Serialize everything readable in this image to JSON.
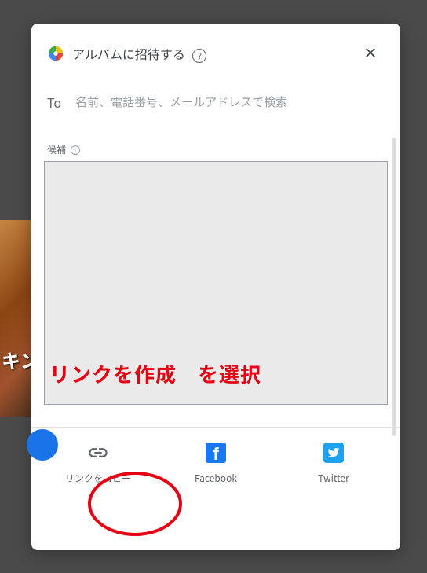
{
  "background": {
    "teaser_text": "キン"
  },
  "modal": {
    "title": "アルバムに招待する",
    "to_label": "To",
    "to_placeholder": "名前、電話番号、メールアドレスで検索",
    "suggestions_label": "候補"
  },
  "annotation": {
    "instruction": "リンクを作成　を選択"
  },
  "share": {
    "copy_link": "リンクをコピー",
    "facebook": "Facebook",
    "twitter": "Twitter"
  }
}
